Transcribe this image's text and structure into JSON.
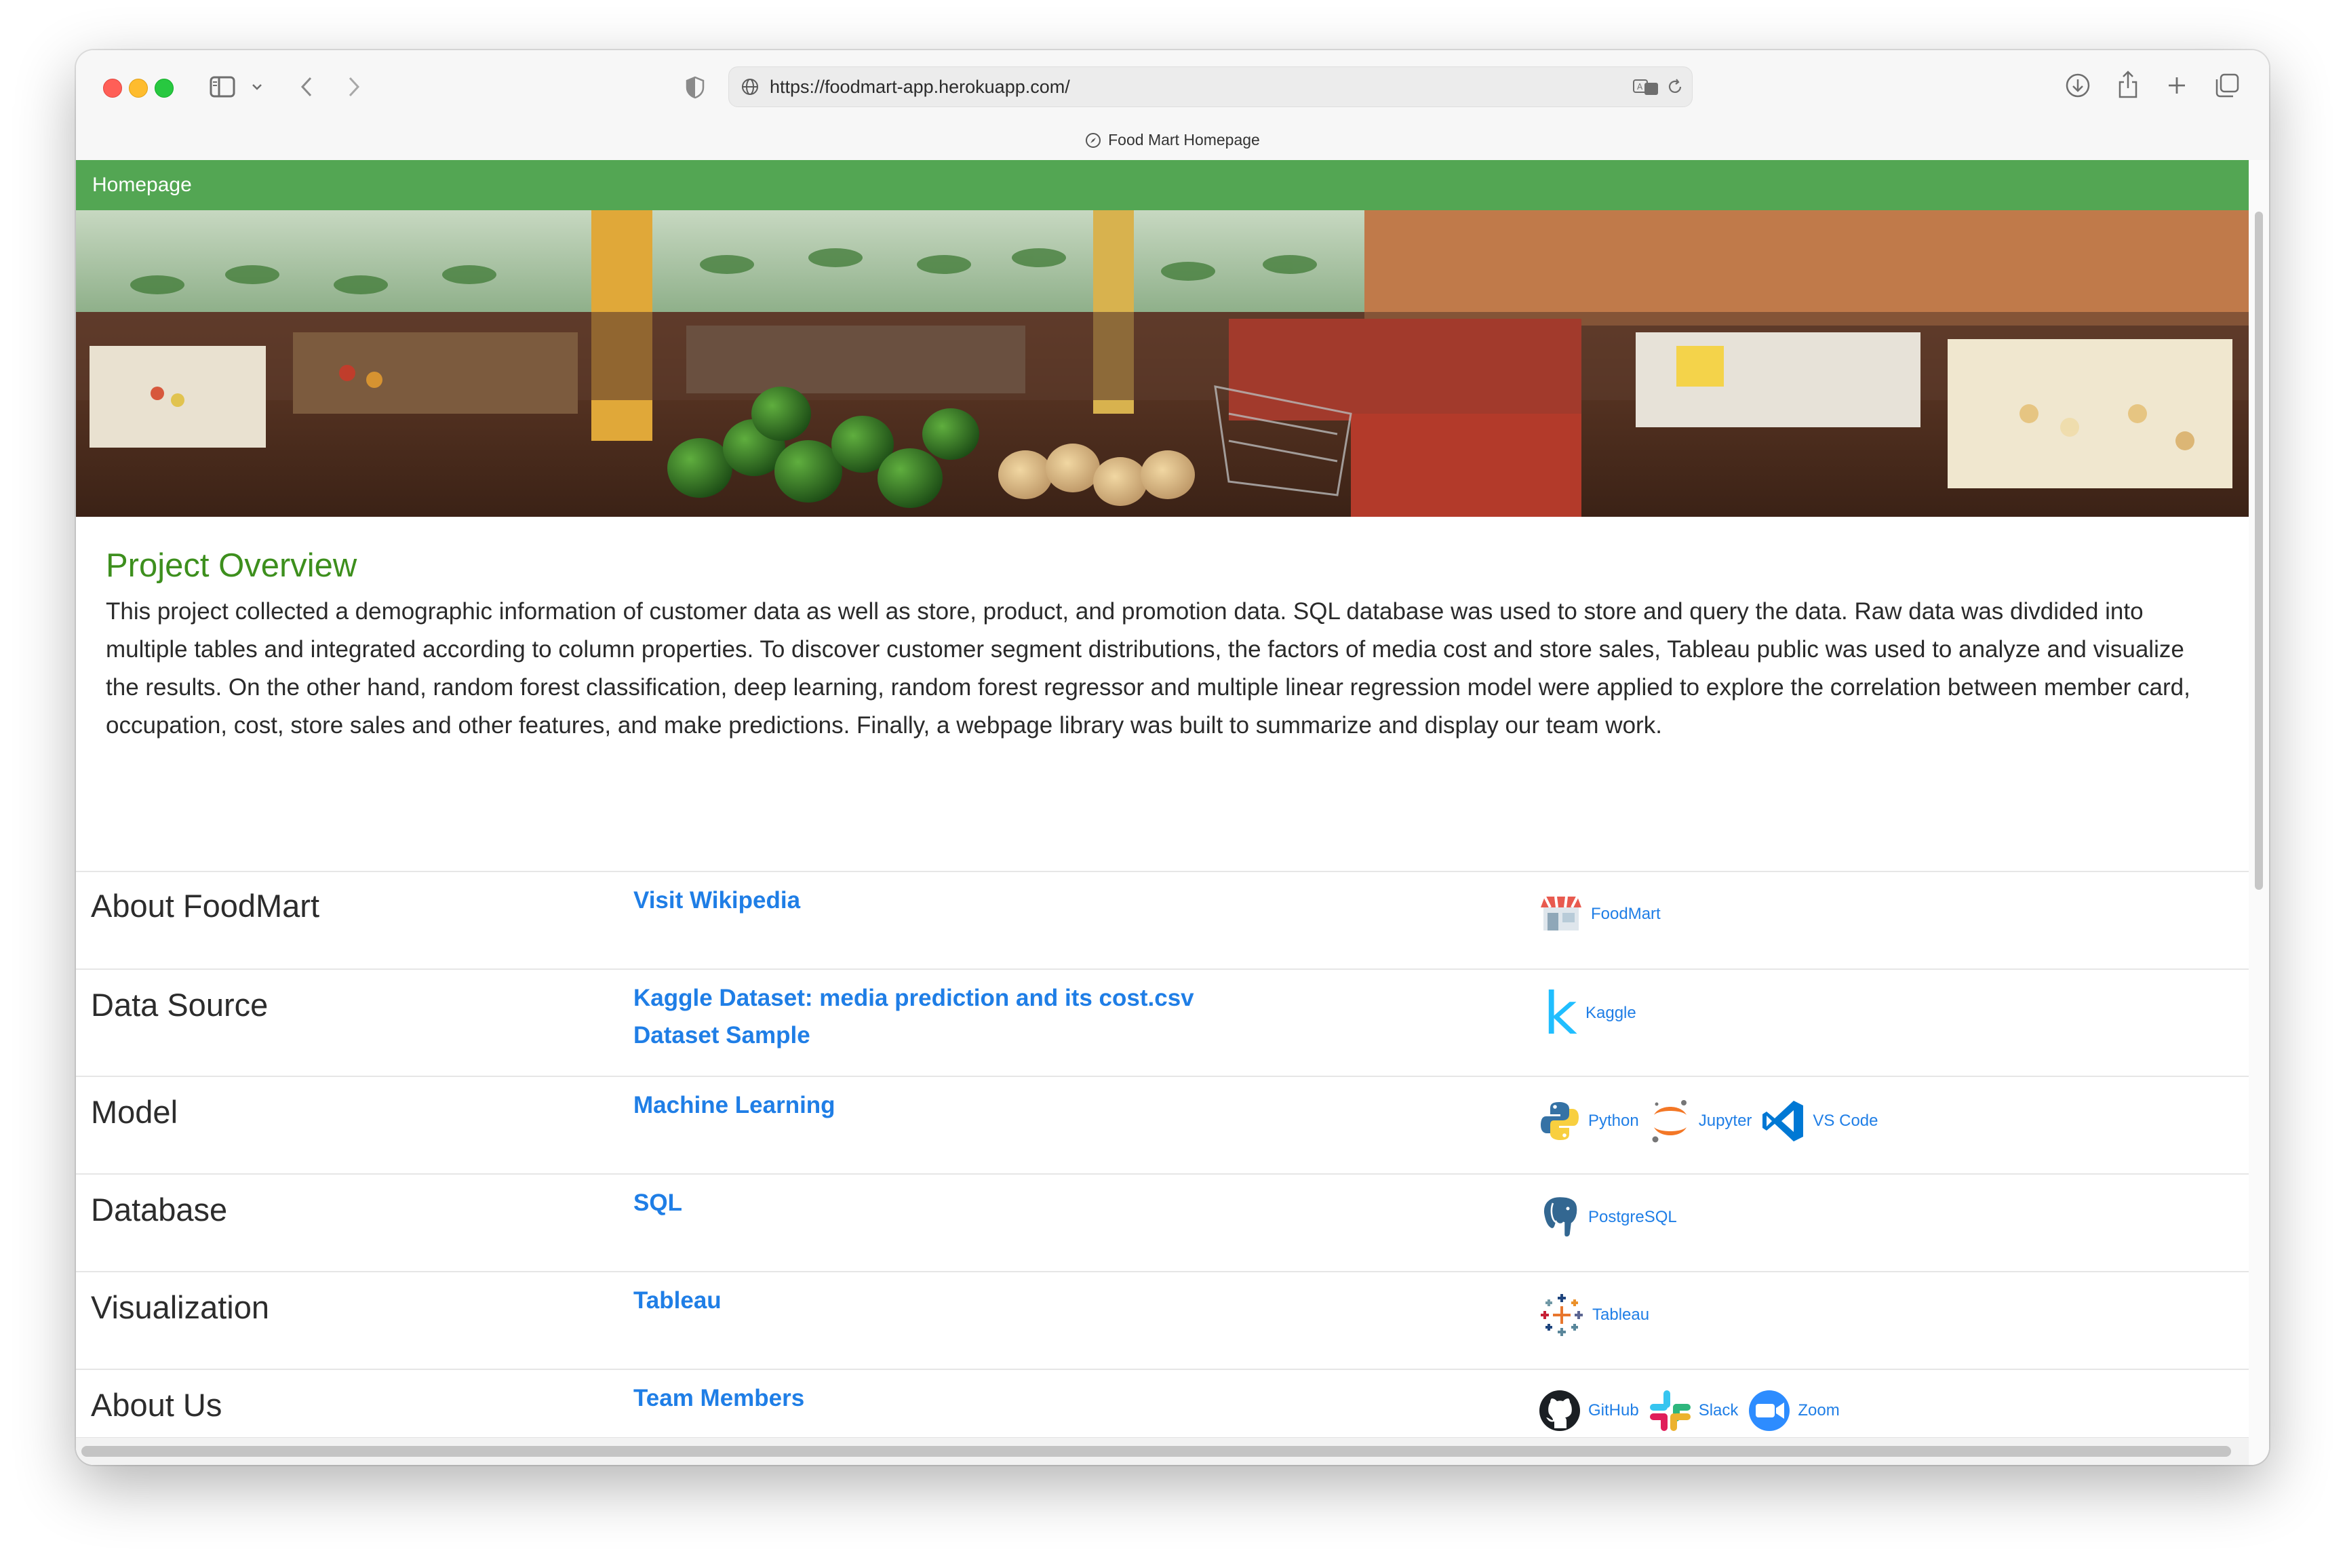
{
  "browser": {
    "url": "https://foodmart-app.herokuapp.com/",
    "tab_title": "Food Mart Homepage"
  },
  "nav": {
    "brand": "Homepage"
  },
  "overview": {
    "title": "Project Overview",
    "text": "This project collected a demographic information of customer data as well as store, product, and promotion data. SQL database was used to store and query the data. Raw data was divdided into multiple tables and integrated according to column properties. To discover customer segment distributions, the factors of media cost and store sales, Tableau public was used to analyze and visualize the results. On the other hand, random forest classification, deep learning, random forest regressor and multiple linear regression model were applied to explore the correlation between member card, occupation, cost, store sales and other features, and make predictions. Finally, a webpage library was built to summarize and display our team work."
  },
  "rows": [
    {
      "label": "About FoodMart",
      "links": [
        "Visit Wikipedia"
      ],
      "tools": [
        {
          "icon": "store-icon",
          "label": "FoodMart"
        }
      ]
    },
    {
      "label": "Data Source",
      "links": [
        "Kaggle Dataset: media prediction and its cost.csv",
        "Dataset Sample"
      ],
      "tools": [
        {
          "icon": "kaggle-icon",
          "label": "Kaggle"
        }
      ]
    },
    {
      "label": "Model",
      "links": [
        "Machine Learning"
      ],
      "tools": [
        {
          "icon": "python-icon",
          "label": "Python"
        },
        {
          "icon": "jupyter-icon",
          "label": "Jupyter"
        },
        {
          "icon": "vscode-icon",
          "label": "VS Code"
        }
      ]
    },
    {
      "label": "Database",
      "links": [
        "SQL"
      ],
      "tools": [
        {
          "icon": "postgresql-icon",
          "label": "PostgreSQL"
        }
      ]
    },
    {
      "label": "Visualization",
      "links": [
        "Tableau"
      ],
      "tools": [
        {
          "icon": "tableau-icon",
          "label": "Tableau"
        }
      ]
    },
    {
      "label": "About Us",
      "links": [
        "Team Members"
      ],
      "tools": [
        {
          "icon": "github-icon",
          "label": "GitHub"
        },
        {
          "icon": "slack-icon",
          "label": "Slack"
        },
        {
          "icon": "zoom-icon",
          "label": "Zoom"
        }
      ]
    }
  ],
  "colors": {
    "navbar": "#53a653",
    "overview_title": "#3d8f1d",
    "link": "#1f7ee6"
  }
}
